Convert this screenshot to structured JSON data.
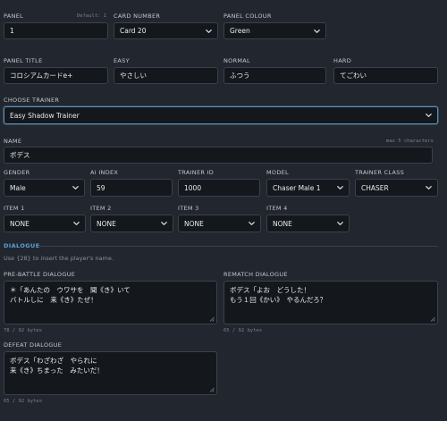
{
  "labels": {
    "panel": "PANEL",
    "panel_default": "Default: 1",
    "card_number": "CARD NUMBER",
    "panel_colour": "PANEL COLOUR",
    "panel_title": "PANEL TITLE",
    "easy": "EASY",
    "normal": "NORMAL",
    "hard": "HARD",
    "choose_trainer": "CHOOSE TRAINER",
    "name": "NAME",
    "name_hint": "max 5 characters",
    "gender": "GENDER",
    "ai_index": "AI INDEX",
    "trainer_id": "TRAINER ID",
    "model": "MODEL",
    "trainer_class": "TRAINER CLASS",
    "item1": "ITEM 1",
    "item2": "ITEM 2",
    "item3": "ITEM 3",
    "item4": "ITEM 4",
    "dialogue": "DIALOGUE",
    "dialogue_help": "Use {28} to insert the player's name.",
    "pre_battle": "PRE-BATTLE DIALOGUE",
    "rematch": "REMATCH DIALOGUE",
    "defeat": "DEFEAT DIALOGUE"
  },
  "values": {
    "panel": "1",
    "card_number": "Card 20",
    "panel_colour": "Green",
    "panel_title": "コロシアムカードe+",
    "easy": "やさしい",
    "normal": "ふつう",
    "hard": "てごわい",
    "trainer": "Easy Shadow Trainer",
    "name": "ボデス",
    "gender": "Male",
    "ai_index": "59",
    "trainer_id": "1000",
    "model": "Chaser Male 1",
    "trainer_class": "CHASER",
    "item1": "NONE",
    "item2": "NONE",
    "item3": "NONE",
    "item4": "NONE"
  },
  "dialogue": {
    "pre_battle": "＊「あんたの　ウワサを　聞《き》いて\nバトルしに　来《き》たぜ！",
    "pre_battle_count": "78 / 92 bytes",
    "rematch": "ボデス「よお　どうした！\nもう１回《かい》　やるんだろ？",
    "rematch_count": "65 / 92 bytes",
    "defeat": "ボデス「わざわざ　やられに\n来《き》ちまった　みたいだ！",
    "defeat_count": "65 / 92 bytes"
  },
  "icons": {
    "dropdown": "chevron-down-icon",
    "resize": "resize-grip-icon"
  },
  "colors": {
    "background": "#22262e",
    "field": "#14171c",
    "border": "#3b414b",
    "accent": "#5aa2d6",
    "focus": "#5a8fb8"
  }
}
